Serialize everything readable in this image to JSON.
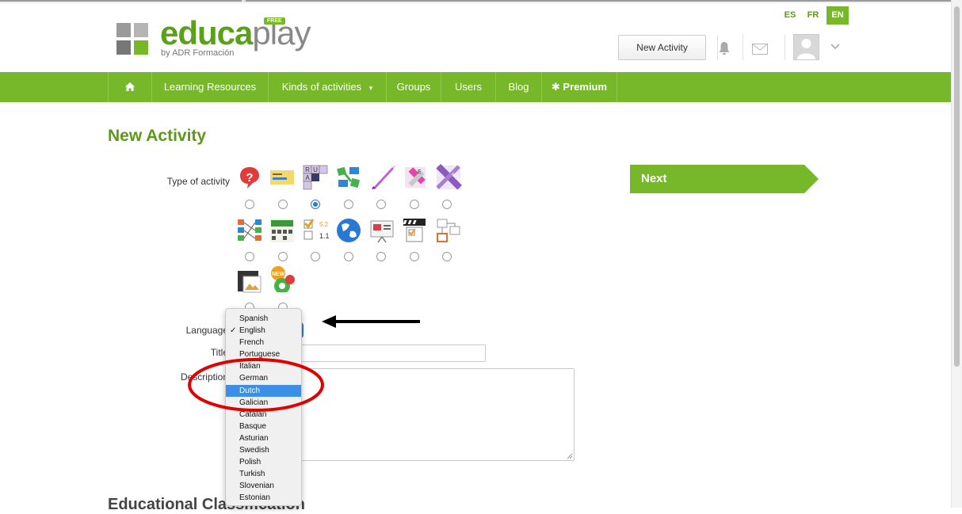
{
  "header": {
    "logo": {
      "word_a": "educa",
      "word_b": "play",
      "free_badge": "FREE",
      "subtitle": "by ADR Formación"
    },
    "languages": [
      {
        "code": "ES",
        "active": false
      },
      {
        "code": "FR",
        "active": false
      },
      {
        "code": "EN",
        "active": true
      }
    ],
    "new_activity_label": "New Activity",
    "icons": [
      "bell-icon",
      "envelope-icon",
      "user-avatar-icon",
      "chevron-down-icon"
    ]
  },
  "nav": {
    "home_icon": "home-icon",
    "items": [
      {
        "label": "Learning Resources"
      },
      {
        "label": "Kinds of activities",
        "has_dropdown": true
      },
      {
        "label": "Groups"
      },
      {
        "label": "Users"
      },
      {
        "label": "Blog"
      },
      {
        "label": "✱ Premium",
        "bold": true
      }
    ]
  },
  "main": {
    "title": "New Activity",
    "type_label": "Type of activity",
    "language_label": "Language",
    "title_label": "Title",
    "description_label": "Description",
    "next_label": "Next",
    "section_heading": "Educational Classification",
    "activity_types": [
      {
        "icon": "question-icon",
        "selected": false
      },
      {
        "icon": "fill-blank-icon",
        "selected": false
      },
      {
        "icon": "crossword-icon",
        "selected": true
      },
      {
        "icon": "relate-icon",
        "selected": false
      },
      {
        "icon": "dictation-icon",
        "selected": false
      },
      {
        "icon": "word-search-icon",
        "selected": false
      },
      {
        "icon": "alphabet-icon",
        "selected": false
      },
      {
        "icon": "matching-columns-icon",
        "selected": false
      },
      {
        "icon": "scramble-icon",
        "selected": false
      },
      {
        "icon": "quiz-icon",
        "selected": false
      },
      {
        "icon": "map-icon",
        "selected": false
      },
      {
        "icon": "presentation-icon",
        "selected": false
      },
      {
        "icon": "video-quiz-icon",
        "selected": false
      },
      {
        "icon": "diagram-icon",
        "selected": false
      },
      {
        "icon": "image-icon",
        "selected": false
      },
      {
        "icon": "new-game-icon",
        "selected": false
      }
    ]
  },
  "language_dropdown": {
    "selected": "English",
    "highlighted": "Dutch",
    "options": [
      "Spanish",
      "English",
      "French",
      "Portuguese",
      "Italian",
      "German",
      "Dutch",
      "Galician",
      "Catalan",
      "Basque",
      "Asturian",
      "Swedish",
      "Polish",
      "Turkish",
      "Slovenian",
      "Estonian"
    ]
  },
  "colors": {
    "brand_green": "#76b82a",
    "title_green": "#5c9a16",
    "highlight_blue": "#3d8ee6",
    "annotation_red": "#e00000"
  }
}
